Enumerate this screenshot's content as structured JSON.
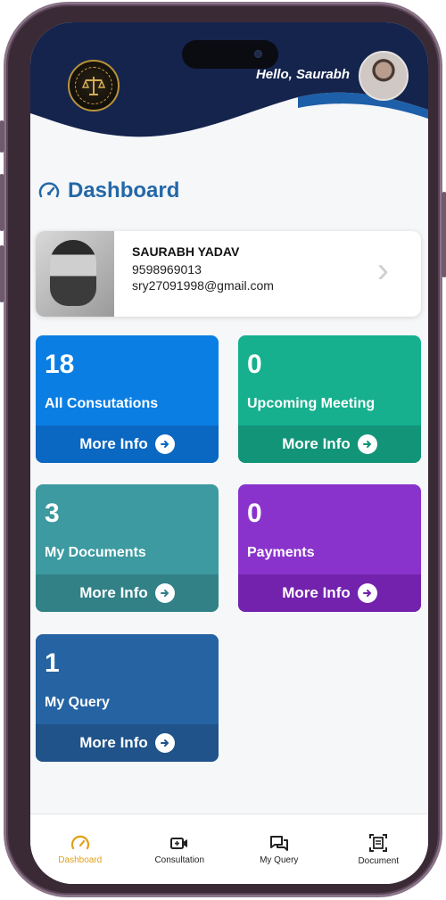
{
  "header": {
    "greeting": "Hello, Saurabh"
  },
  "dashboard": {
    "title": "Dashboard"
  },
  "profile": {
    "name": "SAURABH YADAV",
    "phone": "9598969013",
    "email": "sry27091998@gmail.com"
  },
  "tiles": [
    {
      "count": "18",
      "label": "All Consutations",
      "more": "More Info",
      "color": "#0b7ee3",
      "footer_color": "#0a67c2"
    },
    {
      "count": "0",
      "label": "Upcoming Meeting",
      "more": "More Info",
      "color": "#16b08f",
      "footer_color": "#129478"
    },
    {
      "count": "3",
      "label": "My Documents",
      "more": "More Info",
      "color": "#3c9aa0",
      "footer_color": "#318187"
    },
    {
      "count": "0",
      "label": "Payments",
      "more": "More Info",
      "color": "#8a33cc",
      "footer_color": "#7322ad"
    },
    {
      "count": "1",
      "label": "My Query",
      "more": "More Info",
      "color": "#2563a3",
      "footer_color": "#1f5389"
    }
  ],
  "bottom_nav": {
    "items": [
      {
        "label": "Dashboard",
        "icon": "gauge-icon",
        "active": true
      },
      {
        "label": "Consultation",
        "icon": "video-icon",
        "active": false
      },
      {
        "label": "My Query",
        "icon": "chat-icon",
        "active": false
      },
      {
        "label": "Document",
        "icon": "document-icon",
        "active": false
      }
    ],
    "active_color": "#e2a014"
  },
  "colors": {
    "header_bg": "#14244d",
    "accent_blue": "#2368a8"
  }
}
